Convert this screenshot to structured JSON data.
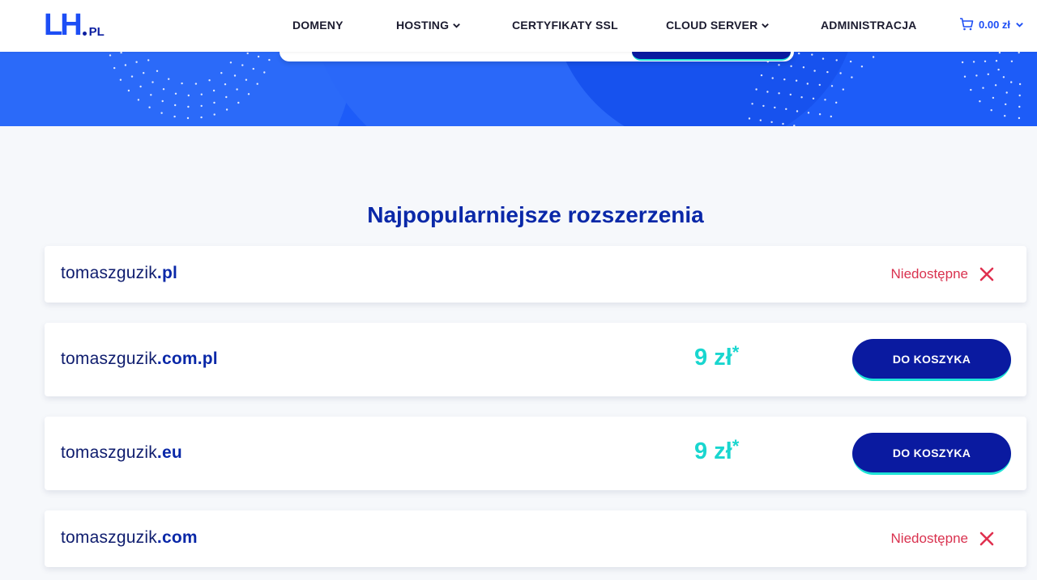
{
  "header": {
    "logo_main": "LH",
    "logo_suffix": "PL",
    "nav": [
      {
        "label": "DOMENY"
      },
      {
        "label": "HOSTING"
      },
      {
        "label": "CERTYFIKATY SSL"
      },
      {
        "label": "CLOUD SERVER"
      },
      {
        "label": "ADMINISTRACJA"
      }
    ],
    "cart_total": "0.00 zł"
  },
  "section": {
    "title": "Najpopularniejsze rozszerzenia",
    "rows": [
      {
        "name": "tomaszguzik",
        "tld": ".pl",
        "status": "Niedostępne"
      },
      {
        "name": "tomaszguzik",
        "tld": ".com.pl",
        "price": "9 zł",
        "price_mark": "*",
        "button": "DO KOSZYKA"
      },
      {
        "name": "tomaszguzik",
        "tld": ".eu",
        "price": "9 zł",
        "price_mark": "*",
        "button": "DO KOSZYKA"
      },
      {
        "name": "tomaszguzik",
        "tld": ".com",
        "status": "Niedostępne"
      }
    ]
  },
  "colors": {
    "brand_blue": "#1d5cf8",
    "navy": "#0a1aa0",
    "accent_teal": "#1ee3d6",
    "price_teal": "#19d6cf",
    "unavailable_red": "#d9324f"
  },
  "icons": {
    "chevron": "chevron-down-icon",
    "cart": "cart-icon",
    "close": "close-icon"
  }
}
